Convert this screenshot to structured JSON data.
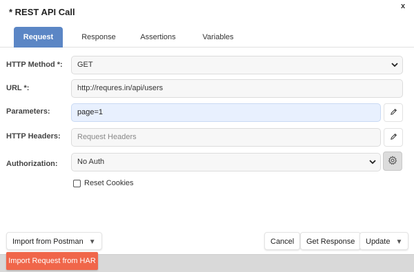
{
  "dialog": {
    "title": "* REST API Call",
    "close_label": "x"
  },
  "tabs": [
    {
      "label": "Request",
      "active": true
    },
    {
      "label": "Response",
      "active": false
    },
    {
      "label": "Assertions",
      "active": false
    },
    {
      "label": "Variables",
      "active": false
    }
  ],
  "form": {
    "http_method": {
      "label": "HTTP Method *:",
      "value": "GET"
    },
    "url": {
      "label": "URL *:",
      "value": "http://requres.in/api/users"
    },
    "parameters": {
      "label": "Parameters:",
      "value": "page=1"
    },
    "http_headers": {
      "label": "HTTP Headers:",
      "placeholder": "Request Headers"
    },
    "authorization": {
      "label": "Authorization:",
      "value": "No Auth"
    },
    "reset_cookies": {
      "label": "Reset Cookies",
      "checked": false
    }
  },
  "footer": {
    "import_postman": "Import from Postman",
    "cancel": "Cancel",
    "get_response": "Get Response",
    "update": "Update",
    "import_har": "Import Request from HAR"
  },
  "colors": {
    "active_tab": "#5b86c5",
    "har_button": "#f0664a",
    "active_field": "#e8f0fe"
  }
}
